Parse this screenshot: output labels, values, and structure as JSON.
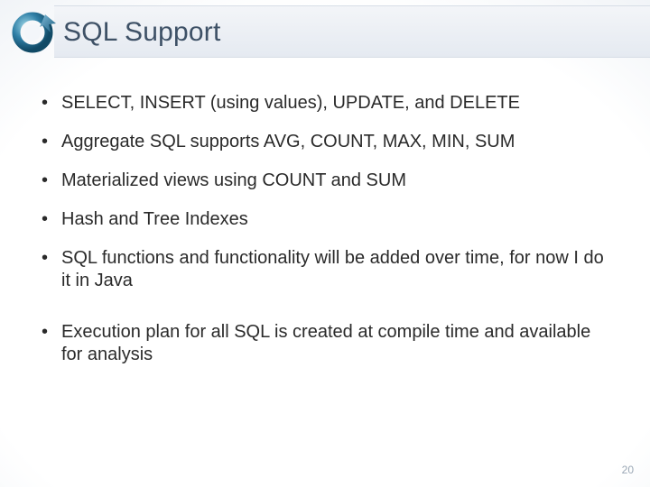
{
  "slide": {
    "title": "SQL Support",
    "bullets_group1": [
      "SELECT, INSERT (using values), UPDATE, and DELETE",
      "Aggregate SQL supports AVG, COUNT, MAX, MIN, SUM",
      "Materialized views using COUNT and SUM",
      "Hash and Tree Indexes",
      "SQL functions and functionality will be added over time, for now I do it in Java"
    ],
    "bullets_group2": [
      "Execution plan for all SQL is created at compile time and available for analysis"
    ],
    "page_number": "20"
  }
}
